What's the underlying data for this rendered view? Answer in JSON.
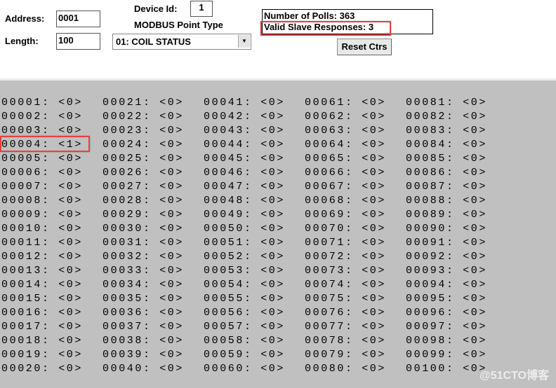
{
  "form": {
    "address_label": "Address:",
    "address_value": "0001",
    "length_label": "Length:",
    "length_value": "100",
    "device_id_label": "Device Id:",
    "device_id_value": "1",
    "point_type_label": "MODBUS Point Type",
    "point_type_value": "01: COIL STATUS"
  },
  "counters": {
    "polls": "Number of Polls: 363",
    "valid": "Valid Slave Responses: 3",
    "reset_label": "Reset Ctrs"
  },
  "highlight_color": "#e84040",
  "cells": [],
  "values": [
    0,
    0,
    0,
    1,
    0,
    0,
    0,
    0,
    0,
    0,
    0,
    0,
    0,
    0,
    0,
    0,
    0,
    0,
    0,
    0,
    0,
    0,
    0,
    0,
    0,
    0,
    0,
    0,
    0,
    0,
    0,
    0,
    0,
    0,
    0,
    0,
    0,
    0,
    0,
    0,
    0,
    0,
    0,
    0,
    0,
    0,
    0,
    0,
    0,
    0,
    0,
    0,
    0,
    0,
    0,
    0,
    0,
    0,
    0,
    0,
    0,
    0,
    0,
    0,
    0,
    0,
    0,
    0,
    0,
    0,
    0,
    0,
    0,
    0,
    0,
    0,
    0,
    0,
    0,
    0,
    0,
    0,
    0,
    0,
    0,
    0,
    0,
    0,
    0,
    0,
    0,
    0,
    0,
    0,
    0,
    0,
    0,
    0,
    0,
    0
  ],
  "watermark": "@51CTO博客"
}
